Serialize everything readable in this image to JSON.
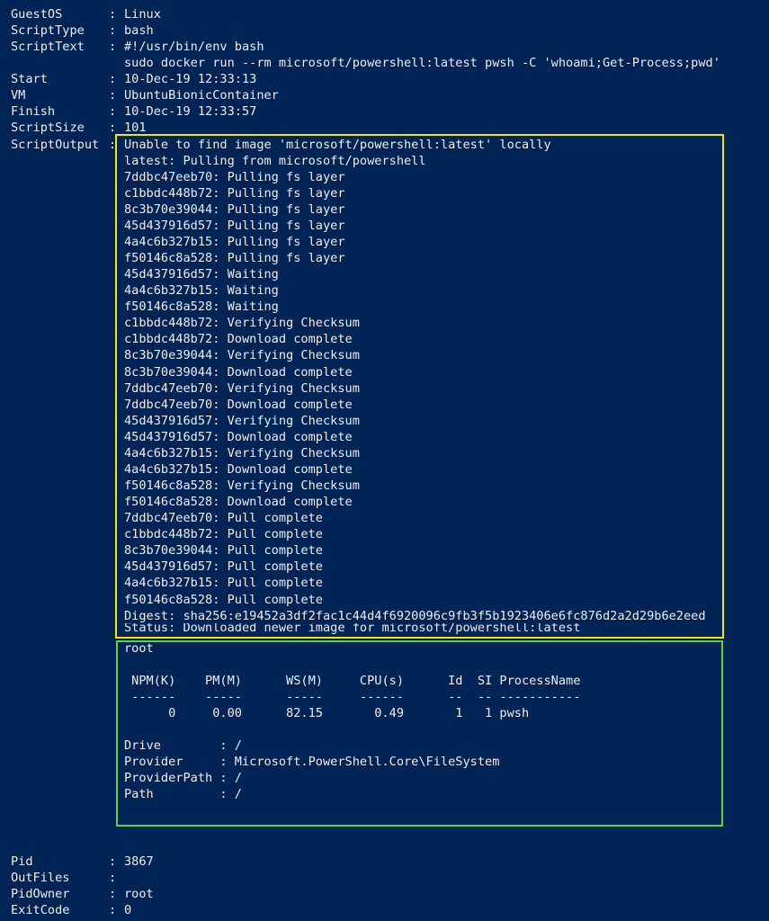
{
  "header_props": [
    {
      "key": "GuestOS",
      "value": "Linux"
    },
    {
      "key": "ScriptType",
      "value": "bash"
    },
    {
      "key": "ScriptText",
      "value": "#!/usr/bin/env bash"
    },
    {
      "key": "",
      "value": "sudo docker run --rm microsoft/powershell:latest pwsh -C 'whoami;Get-Process;pwd'"
    },
    {
      "key": "Start",
      "value": "10-Dec-19 12:33:13"
    },
    {
      "key": "VM",
      "value": "UbuntuBionicContainer"
    },
    {
      "key": "Finish",
      "value": "10-Dec-19 12:33:57"
    },
    {
      "key": "ScriptSize",
      "value": "101"
    },
    {
      "key": "ScriptOutput",
      "value": "Unable to find image 'microsoft/powershell:latest' locally"
    }
  ],
  "pull_log": [
    "latest: Pulling from microsoft/powershell",
    "7ddbc47eeb70: Pulling fs layer",
    "c1bbdc448b72: Pulling fs layer",
    "8c3b70e39044: Pulling fs layer",
    "45d437916d57: Pulling fs layer",
    "4a4c6b327b15: Pulling fs layer",
    "f50146c8a528: Pulling fs layer",
    "45d437916d57: Waiting",
    "4a4c6b327b15: Waiting",
    "f50146c8a528: Waiting",
    "c1bbdc448b72: Verifying Checksum",
    "c1bbdc448b72: Download complete",
    "8c3b70e39044: Verifying Checksum",
    "8c3b70e39044: Download complete",
    "7ddbc47eeb70: Verifying Checksum",
    "7ddbc47eeb70: Download complete",
    "45d437916d57: Verifying Checksum",
    "45d437916d57: Download complete",
    "4a4c6b327b15: Verifying Checksum",
    "4a4c6b327b15: Download complete",
    "f50146c8a528: Verifying Checksum",
    "f50146c8a528: Download complete",
    "7ddbc47eeb70: Pull complete",
    "c1bbdc448b72: Pull complete",
    "8c3b70e39044: Pull complete",
    "45d437916d57: Pull complete",
    "4a4c6b327b15: Pull complete",
    "f50146c8a528: Pull complete",
    "Digest: sha256:e19452a3df2fac1c44d4f6920096c9fb3f5b1923406e6fc876d2a2d29b6e2eed"
  ],
  "status_line": "Status: Downloaded newer image for microsoft/powershell:latest",
  "command_output": {
    "whoami": "root",
    "process_header": " NPM(K)    PM(M)      WS(M)     CPU(s)      Id  SI ProcessName",
    "process_sep": " ------    -----      -----     ------      --  -- -----------",
    "process_row": "      0     0.00      82.15       0.49       1   1 pwsh",
    "pwd": [
      "Drive        : /",
      "Provider     : Microsoft.PowerShell.Core\\FileSystem",
      "ProviderPath : /",
      "Path         : /"
    ]
  },
  "footer_props": [
    {
      "key": "Pid",
      "value": "3867"
    },
    {
      "key": "OutFiles",
      "value": ""
    },
    {
      "key": "PidOwner",
      "value": "root"
    },
    {
      "key": "ExitCode",
      "value": "0"
    }
  ],
  "colors": {
    "background": "#012456",
    "text": "#eeedf0",
    "highlight_yellow": "#f2e500",
    "highlight_green": "#5fd33a"
  }
}
